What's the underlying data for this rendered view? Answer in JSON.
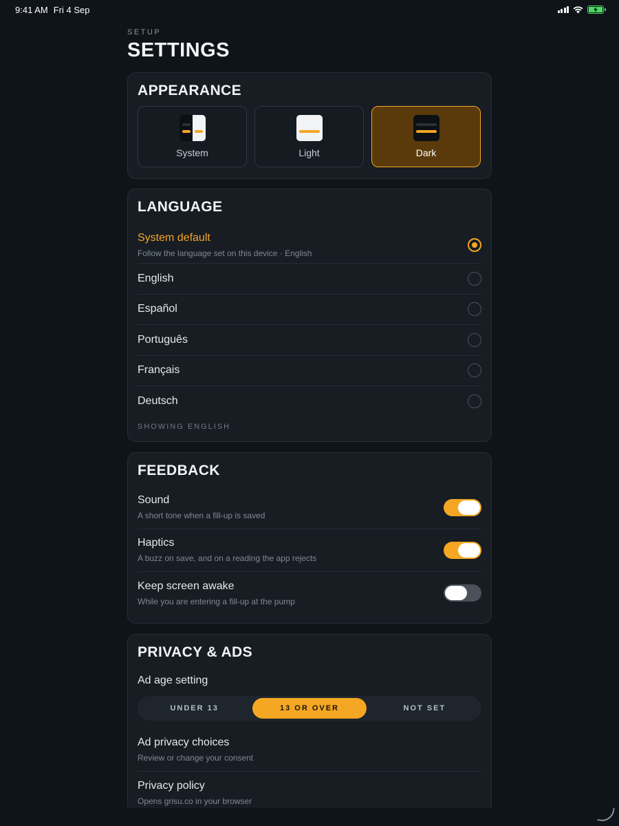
{
  "status_bar": {
    "time": "9:41 AM",
    "date": "Fri 4 Sep"
  },
  "header": {
    "eyebrow": "SETUP",
    "title": "SETTINGS"
  },
  "appearance": {
    "title": "APPEARANCE",
    "options": [
      {
        "label": "System",
        "icon": "system-theme-icon",
        "selected": false
      },
      {
        "label": "Light",
        "icon": "light-theme-icon",
        "selected": false
      },
      {
        "label": "Dark",
        "icon": "dark-theme-icon",
        "selected": true
      }
    ]
  },
  "language": {
    "title": "LANGUAGE",
    "default_label": "System default",
    "default_sub": "Follow the language set on this device · English",
    "languages": [
      "English",
      "Español",
      "Português",
      "Français",
      "Deutsch"
    ],
    "footnote": "SHOWING ENGLISH"
  },
  "feedback": {
    "title": "FEEDBACK",
    "items": [
      {
        "title": "Sound",
        "sub": "A short tone when a fill-up is saved",
        "on": true
      },
      {
        "title": "Haptics",
        "sub": "A buzz on save, and on a reading the app rejects",
        "on": true
      },
      {
        "title": "Keep screen awake",
        "sub": "While you are entering a fill-up at the pump",
        "on": false
      }
    ]
  },
  "privacy": {
    "title": "PRIVACY & ADS",
    "ad_age_label": "Ad age setting",
    "ad_age_options": [
      "UNDER 13",
      "13 OR OVER",
      "NOT SET"
    ],
    "ad_age_selected": "13 OR OVER",
    "items": [
      {
        "title": "Ad privacy choices",
        "sub": "Review or change your consent"
      },
      {
        "title": "Privacy policy",
        "sub": "Opens grisu.co in your browser"
      }
    ]
  },
  "colors": {
    "background": "#0f1419",
    "card": "#171d23",
    "accent": "#f5a623",
    "selected_tile": "#5a3a0a",
    "battery": "#4cd964"
  }
}
